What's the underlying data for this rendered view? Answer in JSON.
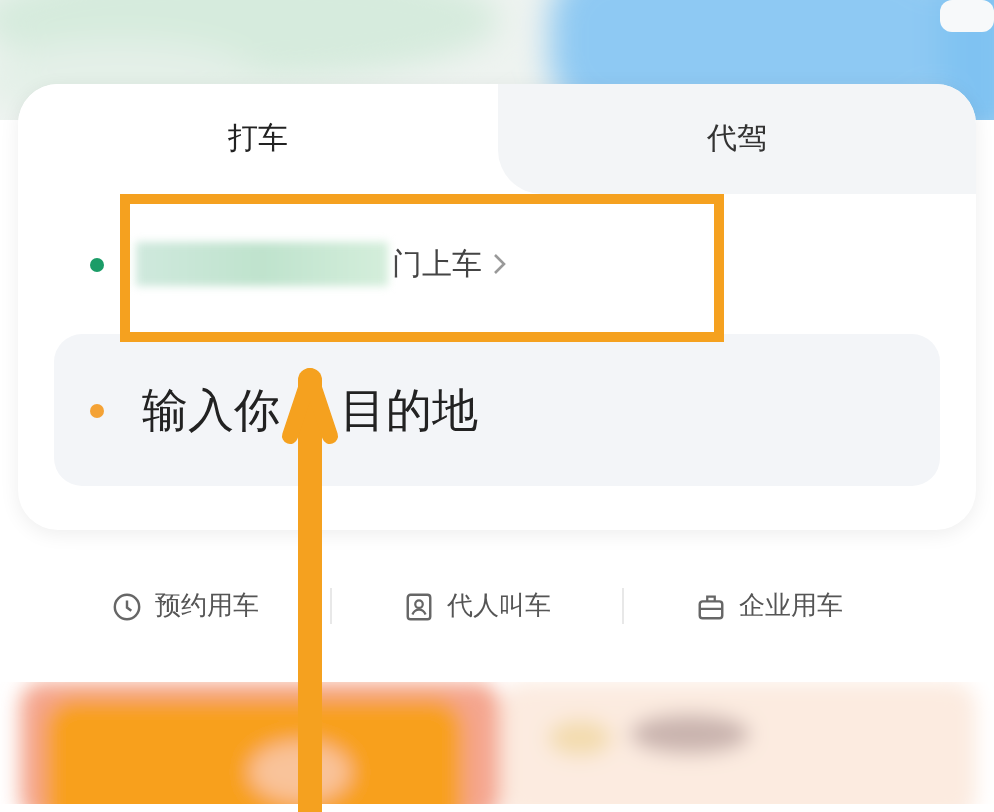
{
  "tabs": [
    {
      "label": "打车",
      "selected": true
    },
    {
      "label": "代驾",
      "selected": false
    }
  ],
  "pickup": {
    "suffix": "门上车"
  },
  "destination": {
    "text_before_arrow": "输入你",
    "text_after_arrow": "目的地"
  },
  "shortcuts": [
    {
      "label": "预约用车"
    },
    {
      "label": "代人叫车"
    },
    {
      "label": "企业用车"
    }
  ]
}
